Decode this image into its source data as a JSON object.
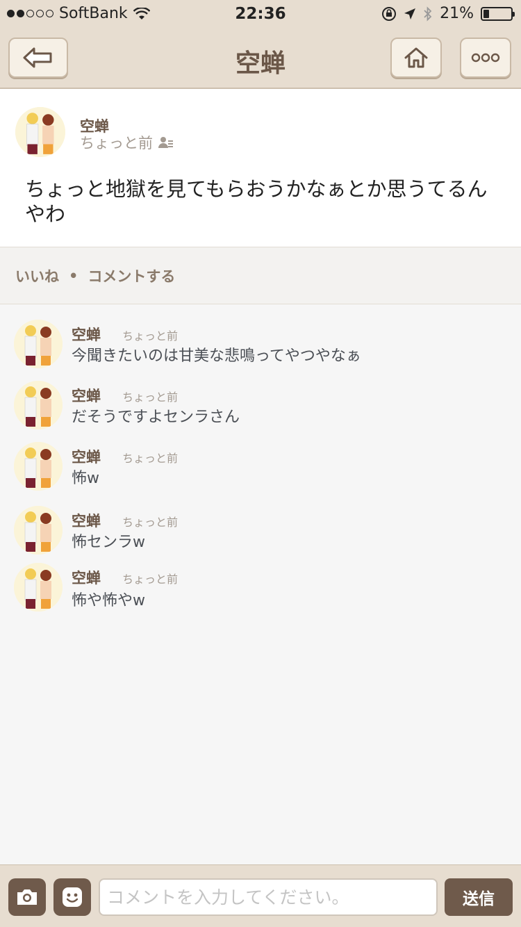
{
  "status_bar": {
    "carrier": "SoftBank",
    "time": "22:36",
    "battery": "21%",
    "battery_level": 0.21,
    "signal_bars_filled": 2,
    "signal_bars_total": 5
  },
  "nav": {
    "title": "空蝉",
    "back_icon": "back-arrow-icon",
    "home_icon": "home-icon",
    "more_icon": "more-icon"
  },
  "post": {
    "author": "空蝉",
    "time": "ちょっと前",
    "visibility_icon": "contacts-icon",
    "body": "ちょっと地獄を見てもらおうかなぁとか思うてるんやわ"
  },
  "actions": {
    "like": "いいね",
    "separator": "•",
    "comment": "コメントする"
  },
  "comments": [
    {
      "author": "空蝉",
      "time": "ちょっと前",
      "text": "今聞きたいのは甘美な悲鳴ってやつやなぁ"
    },
    {
      "author": "空蝉",
      "time": "ちょっと前",
      "text": "だそうですよセンラさん"
    },
    {
      "author": "空蝉",
      "time": "ちょっと前",
      "text": "怖w"
    },
    {
      "author": "空蝉",
      "time": "ちょっと前",
      "text": "怖センラw"
    },
    {
      "author": "空蝉",
      "time": "ちょっと前",
      "text": "怖や怖やw"
    }
  ],
  "input_bar": {
    "placeholder": "コメントを入力してください。",
    "send_label": "送信",
    "camera_icon": "camera-icon",
    "emoji_icon": "sticker-icon"
  },
  "colors": {
    "bar_bg": "#e7ddd0",
    "accent_brown": "#6f5a4b",
    "title_brown": "#6b5748"
  }
}
